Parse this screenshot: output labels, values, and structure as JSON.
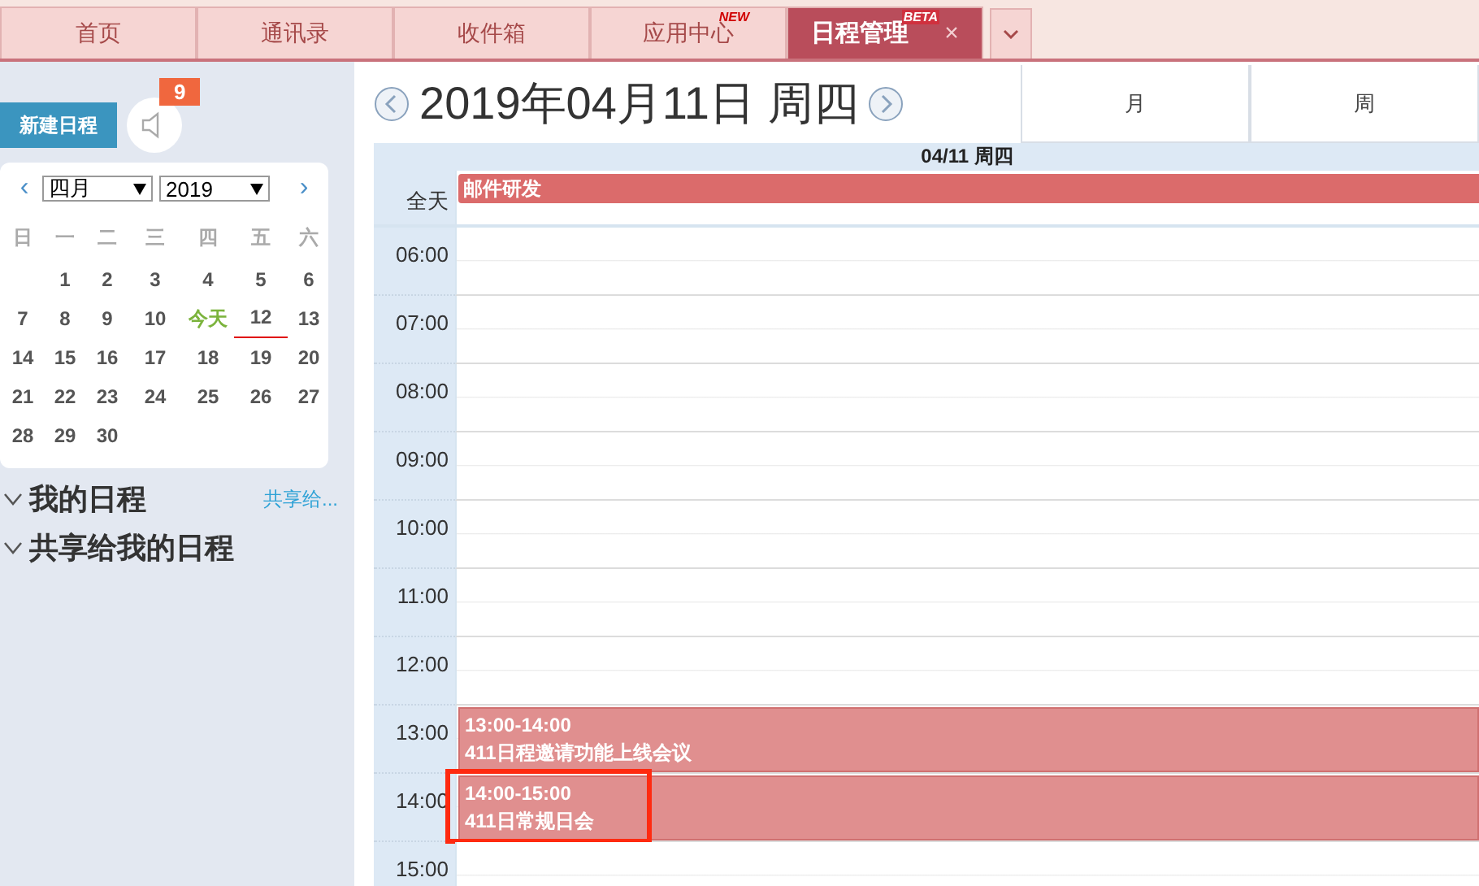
{
  "tabs": [
    {
      "label": "首页",
      "selected": false
    },
    {
      "label": "通讯录",
      "selected": false
    },
    {
      "label": "收件箱",
      "selected": false
    },
    {
      "label": "应用中心",
      "selected": false,
      "badge": "NEW"
    },
    {
      "label": "日程管理",
      "selected": true,
      "badge": "BETA",
      "close": "×"
    }
  ],
  "sidebar": {
    "new_button": "新建日程",
    "notice_count": "9",
    "mini_calendar": {
      "prev": "‹",
      "next": "›",
      "month": "四月",
      "year": "2019",
      "weekdays": [
        "日",
        "一",
        "二",
        "三",
        "四",
        "五",
        "六"
      ],
      "weeks": [
        {
          "kind": "tail",
          "days": [
            {
              "label": "1",
              "kind": "day"
            },
            {
              "label": "2",
              "kind": "day"
            },
            {
              "label": "3",
              "kind": "day"
            },
            {
              "label": "4",
              "kind": "day"
            },
            {
              "label": "5",
              "kind": "day"
            },
            {
              "label": "6",
              "kind": "day"
            }
          ]
        },
        {
          "kind": "full",
          "days": [
            {
              "label": "7",
              "kind": "day"
            },
            {
              "label": "8",
              "kind": "day"
            },
            {
              "label": "9",
              "kind": "day"
            },
            {
              "label": "10",
              "kind": "day"
            },
            {
              "label": "今天",
              "kind": "today"
            },
            {
              "label": "12",
              "kind": "underlined"
            },
            {
              "label": "13",
              "kind": "day"
            }
          ]
        },
        {
          "kind": "full",
          "days": [
            {
              "label": "14",
              "kind": "day"
            },
            {
              "label": "15",
              "kind": "day"
            },
            {
              "label": "16",
              "kind": "day"
            },
            {
              "label": "17",
              "kind": "day"
            },
            {
              "label": "18",
              "kind": "day"
            },
            {
              "label": "19",
              "kind": "day"
            },
            {
              "label": "20",
              "kind": "day"
            }
          ]
        },
        {
          "kind": "full",
          "days": [
            {
              "label": "21",
              "kind": "day"
            },
            {
              "label": "22",
              "kind": "day"
            },
            {
              "label": "23",
              "kind": "day"
            },
            {
              "label": "24",
              "kind": "day"
            },
            {
              "label": "25",
              "kind": "day"
            },
            {
              "label": "26",
              "kind": "day"
            },
            {
              "label": "27",
              "kind": "day"
            }
          ]
        },
        {
          "kind": "head",
          "days": [
            {
              "label": "28",
              "kind": "day"
            },
            {
              "label": "29",
              "kind": "day"
            },
            {
              "label": "30",
              "kind": "day"
            }
          ]
        }
      ]
    },
    "sections": [
      {
        "title": "我的日程",
        "expanded": true,
        "link": "共享给..."
      },
      {
        "title": "共享给我的日程",
        "expanded": true
      }
    ]
  },
  "main": {
    "title": "2019年04月11日 周四",
    "views": [
      {
        "label": "月",
        "selected": false
      },
      {
        "label": "周",
        "selected": false
      }
    ],
    "day_header": "04/11 周四",
    "all_day_label": "全天",
    "all_day_events": [
      {
        "title": "邮件研发"
      }
    ],
    "hours": [
      {
        "label": "06:00"
      },
      {
        "label": "07:00"
      },
      {
        "label": "08:00"
      },
      {
        "label": "09:00"
      },
      {
        "label": "10:00"
      },
      {
        "label": "11:00"
      },
      {
        "label": "12:00"
      },
      {
        "label": "13:00",
        "events": [
          {
            "time": "13:00-14:00",
            "title": "411日程邀请功能上线会议",
            "highlighted": false
          }
        ]
      },
      {
        "label": "14:00",
        "events": [
          {
            "time": "14:00-15:00",
            "title": "411日常规日会",
            "highlighted": true
          }
        ]
      },
      {
        "label": "15:00"
      }
    ]
  }
}
